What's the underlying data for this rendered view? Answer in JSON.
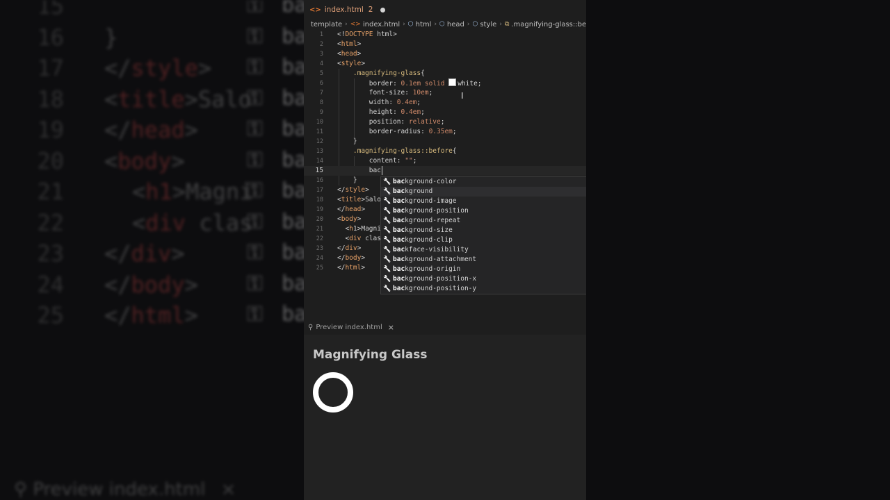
{
  "background_code": {
    "lines": [
      {
        "n": "15",
        "text": "",
        "word": "bac"
      },
      {
        "n": "16",
        "text": "}",
        "word": "ba"
      },
      {
        "n": "17",
        "text": "</style>",
        "word": "ba"
      },
      {
        "n": "18",
        "text": "<title>Salo",
        "word": "ba"
      },
      {
        "n": "19",
        "text": "</head>",
        "word": "ba"
      },
      {
        "n": "20",
        "text": "<body>",
        "word": "ba"
      },
      {
        "n": "21",
        "text": "  <h1>Magni",
        "word": "ba"
      },
      {
        "n": "22",
        "text": "  <div clas",
        "word": "ba"
      },
      {
        "n": "23",
        "text": "</div>",
        "word": "ba"
      },
      {
        "n": "24",
        "text": "</body>",
        "word": "ba"
      },
      {
        "n": "25",
        "text": "</html>",
        "word": "ba"
      }
    ],
    "bottom_label": "Preview index.html",
    "bottom_close": "×"
  },
  "editor": {
    "tab": {
      "label": "index.html",
      "problems": "2",
      "icon": "html-file-icon"
    },
    "breadcrumb": [
      "template",
      "index.html",
      "html",
      "head",
      "style",
      ".magnifying-glass::before"
    ],
    "current_line": "15",
    "lines": [
      {
        "n": "1",
        "text": "<!DOCTYPE html>"
      },
      {
        "n": "2",
        "text": "<html>"
      },
      {
        "n": "3",
        "text": "<head>"
      },
      {
        "n": "4",
        "text": "<style>"
      },
      {
        "n": "5",
        "text": "    .magnifying-glass{"
      },
      {
        "n": "6",
        "text": "        border: 0.1em solid ",
        "swatch": "#ffffff",
        "after": "white;"
      },
      {
        "n": "7",
        "text": "        font-size: 10em;"
      },
      {
        "n": "8",
        "text": "        width: 0.4em;"
      },
      {
        "n": "9",
        "text": "        height: 0.4em;"
      },
      {
        "n": "10",
        "text": "        position: relative;"
      },
      {
        "n": "11",
        "text": "        border-radius: 0.35em;"
      },
      {
        "n": "12",
        "text": "    }"
      },
      {
        "n": "13",
        "text": "    .magnifying-glass::before{"
      },
      {
        "n": "14",
        "text": "        content: \"\";"
      },
      {
        "n": "15",
        "text": "        bac"
      },
      {
        "n": "16",
        "text": "    }"
      },
      {
        "n": "17",
        "text": "</style>"
      },
      {
        "n": "18",
        "text": "<title>Salo"
      },
      {
        "n": "19",
        "text": "</head>"
      },
      {
        "n": "20",
        "text": "<body>"
      },
      {
        "n": "21",
        "text": "  <h1>Magni"
      },
      {
        "n": "22",
        "text": "  <div clas"
      },
      {
        "n": "23",
        "text": "</div>"
      },
      {
        "n": "24",
        "text": "</body>"
      },
      {
        "n": "25",
        "text": "</html>"
      }
    ],
    "suggestions": {
      "typed": "bac",
      "selected_index": 1,
      "items": [
        "background-color",
        "background",
        "background-image",
        "background-position",
        "background-repeat",
        "background-size",
        "background-clip",
        "backface-visibility",
        "background-attachment",
        "background-origin",
        "background-position-x",
        "background-position-y"
      ]
    }
  },
  "preview": {
    "tab_label": "Preview index.html",
    "tab_close": "×",
    "heading": "Magnifying Glass"
  },
  "colors": {
    "editor_bg": "#1e1e1e",
    "tag": "#e8a268",
    "selector": "#d7ba7d",
    "number": "#d08a6a",
    "preview_bg": "#222222",
    "ring": "#ffffff"
  }
}
